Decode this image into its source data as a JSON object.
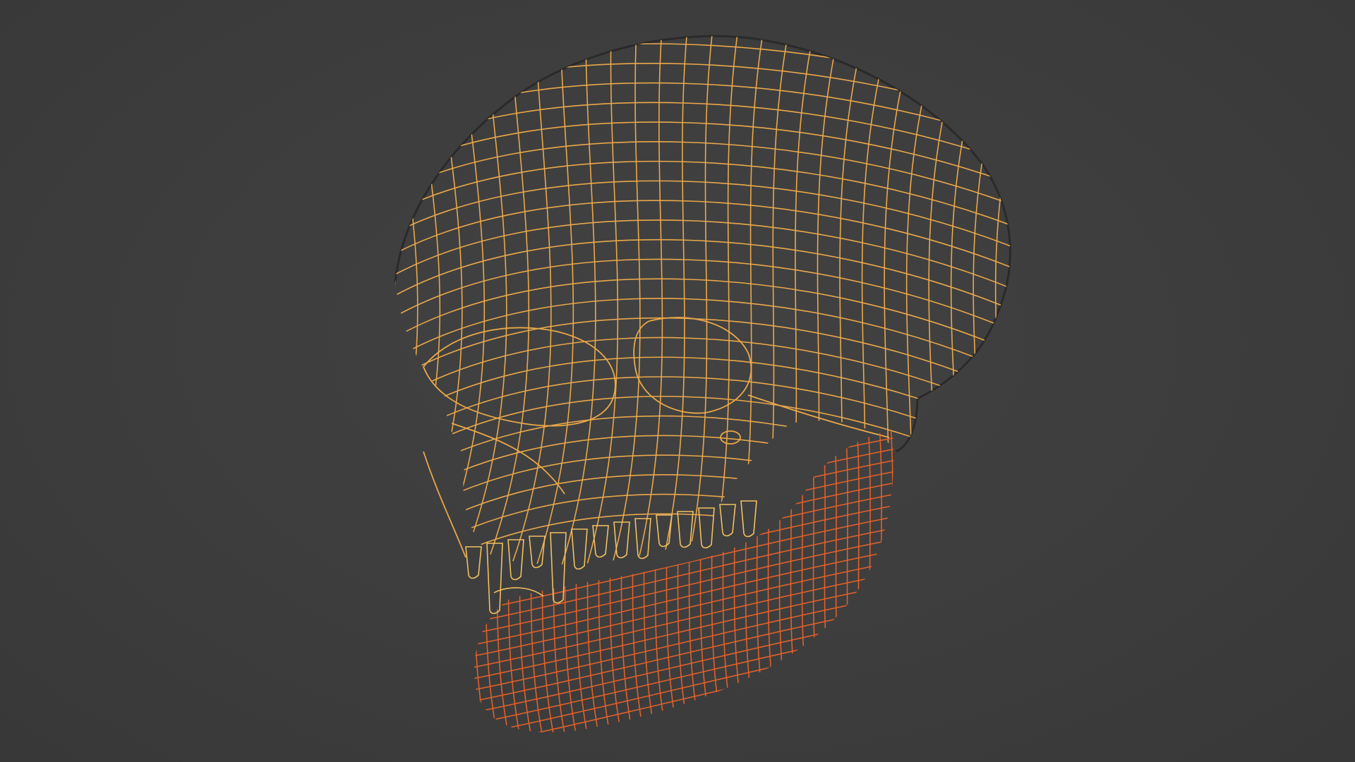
{
  "viewport": {
    "background": "#3d3d3d",
    "display_mode": "wireframe"
  },
  "model": {
    "object": "skull-with-fangs",
    "parts": [
      {
        "name": "cranium",
        "wire_color": "#e9a84a"
      },
      {
        "name": "upper-teeth",
        "wire_color": "#f0c060"
      },
      {
        "name": "mandible",
        "wire_color": "#e0602a"
      }
    ]
  }
}
